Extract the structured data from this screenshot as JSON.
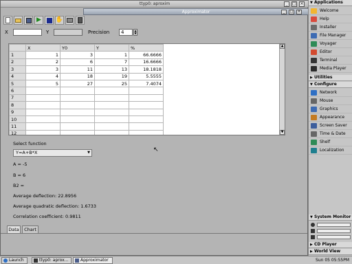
{
  "back_window": {
    "title": "ttyp0: aproxim"
  },
  "app": {
    "title": "Approximator"
  },
  "toolbar": {
    "icons": [
      "new-icon",
      "open-icon",
      "save-icon",
      "run-icon",
      "stop-icon",
      "hand-icon",
      "print-icon",
      "exit-icon"
    ]
  },
  "params": {
    "x_label": "X",
    "x_value": "",
    "y_label": "Y",
    "y_value": "",
    "precision_label": "Precision",
    "precision_value": "4"
  },
  "table": {
    "columns": [
      "X",
      "Y0",
      "Y",
      "%"
    ],
    "rows": [
      {
        "n": "1",
        "x": "1",
        "y0": "3",
        "y": "1",
        "p": "66.6666"
      },
      {
        "n": "2",
        "x": "2",
        "y0": "6",
        "y": "7",
        "p": "16.6666"
      },
      {
        "n": "3",
        "x": "3",
        "y0": "11",
        "y": "13",
        "p": "18.1818"
      },
      {
        "n": "4",
        "x": "4",
        "y0": "18",
        "y": "19",
        "p": "5.5555"
      },
      {
        "n": "5",
        "x": "5",
        "y0": "27",
        "y": "25",
        "p": "7.4074"
      },
      {
        "n": "6",
        "x": "",
        "y0": "",
        "y": "",
        "p": ""
      },
      {
        "n": "7",
        "x": "",
        "y0": "",
        "y": "",
        "p": ""
      },
      {
        "n": "8",
        "x": "",
        "y0": "",
        "y": "",
        "p": ""
      },
      {
        "n": "9",
        "x": "",
        "y0": "",
        "y": "",
        "p": ""
      },
      {
        "n": "10",
        "x": "",
        "y0": "",
        "y": "",
        "p": ""
      },
      {
        "n": "11",
        "x": "",
        "y0": "",
        "y": "",
        "p": ""
      },
      {
        "n": "12",
        "x": "",
        "y0": "",
        "y": "",
        "p": ""
      }
    ]
  },
  "function": {
    "label": "Select function",
    "selected": "Y=A+B*X"
  },
  "results": {
    "a": "A = -5",
    "b": "B = 6",
    "b2": "B2 =",
    "avg_deflection": "Average deflection: 22.8956",
    "avg_quad_deflection": "Average quadratic deflection: 1.6733",
    "correlation": "Correlation coefficient: 0.9811"
  },
  "tabs": [
    "Data",
    "Chart"
  ],
  "panel": {
    "applications": "Applications",
    "app_items": [
      "Welcome",
      "Help",
      "Installer",
      "File Manager",
      "Voyager",
      "Editor",
      "Terminal",
      "Media Player"
    ],
    "utilities": "Utilities",
    "configure": "Configure",
    "config_items": [
      "Network",
      "Mouse",
      "Graphics",
      "Appearance",
      "Screen Saver",
      "Time & Date",
      "Shelf",
      "Localization"
    ],
    "system_monitor": "System Monitor",
    "cd_player": "CD Player",
    "world_view": "World View"
  },
  "taskbar": {
    "launch": "Launch",
    "items": [
      "ttyp0: aprox...",
      "Approximator"
    ],
    "clock": "Sun 05 05:55PM"
  }
}
